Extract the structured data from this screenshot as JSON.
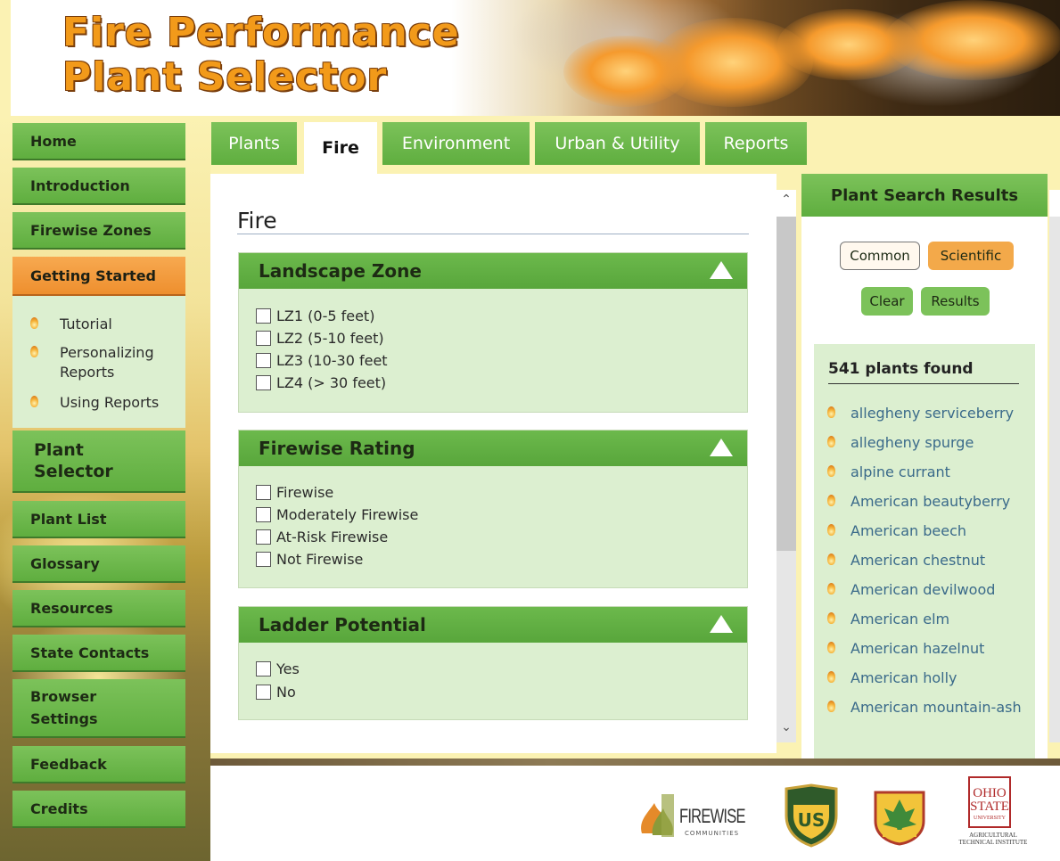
{
  "app": {
    "title_line1": "Fire Performance",
    "title_line2": "Plant Selector"
  },
  "sidebar": {
    "items": [
      {
        "label": "Home"
      },
      {
        "label": "Introduction"
      },
      {
        "label": "Firewise Zones"
      },
      {
        "label": "Getting Started"
      },
      {
        "label": "Plant Selector"
      },
      {
        "label": "Plant List"
      },
      {
        "label": "Glossary"
      },
      {
        "label": "Resources"
      },
      {
        "label": "State Contacts"
      },
      {
        "label": "Browser Settings"
      },
      {
        "label": "Feedback"
      },
      {
        "label": "Credits"
      }
    ],
    "submenu": [
      {
        "label": "Tutorial"
      },
      {
        "label": "Personalizing Reports"
      },
      {
        "label": "Using Reports"
      }
    ]
  },
  "tabs": [
    {
      "label": "Plants"
    },
    {
      "label": "Fire"
    },
    {
      "label": "Environment"
    },
    {
      "label": "Urban & Utility"
    },
    {
      "label": "Reports"
    }
  ],
  "main": {
    "page_title": "Fire",
    "groups": [
      {
        "title": "Landscape Zone",
        "options": [
          "LZ1 (0-5 feet)",
          "LZ2 (5-10 feet)",
          "LZ3 (10-30 feet",
          "LZ4 (> 30 feet)"
        ]
      },
      {
        "title": "Firewise Rating",
        "options": [
          "Firewise",
          "Moderately Firewise",
          "At-Risk Firewise",
          "Not Firewise"
        ]
      },
      {
        "title": "Ladder Potential",
        "options": [
          "Yes",
          "No"
        ]
      }
    ]
  },
  "results": {
    "header": "Plant Search Results",
    "common_label": "Common",
    "scientific_label": "Scientific",
    "clear_label": "Clear",
    "results_label": "Results",
    "count_text": "541 plants found",
    "items": [
      "allegheny serviceberry",
      "allegheny spurge",
      "alpine currant",
      "American beautyberry",
      "American beech",
      "American chestnut",
      "American devilwood",
      "American elm",
      "American hazelnut",
      "American holly",
      "American mountain-ash"
    ]
  },
  "footer": {
    "logos": [
      "firewise-communities-logo",
      "forest-service-logo",
      "west-virginia-division-of-forestry-logo",
      "ohio-state-ati-logo"
    ],
    "firewise_text": "FIREWISE",
    "firewise_sub": "COMMUNITIES",
    "ohio_line1": "OHIO",
    "ohio_line2": "STATE",
    "ohio_line3": "UNIVERSITY",
    "ohio_line4": "AGRICULTURAL TECHNICAL INSTITUTE"
  },
  "colors": {
    "nav_green": "#5fae3f",
    "active_orange": "#ee8f2e",
    "panel_green": "#dcefd0",
    "link_blue": "#3a6a8a",
    "page_bg": "#fbf2b3"
  }
}
